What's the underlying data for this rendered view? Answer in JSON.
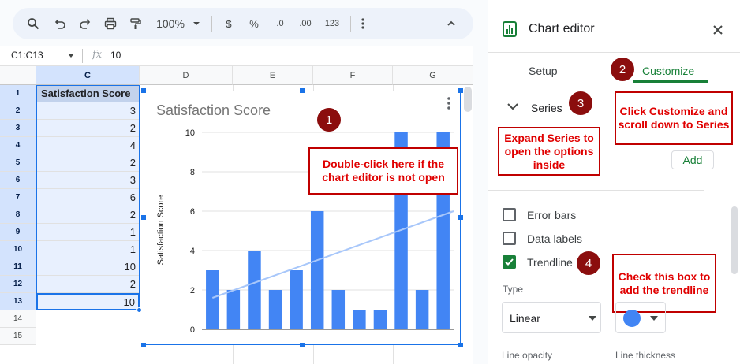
{
  "toolbar": {
    "zoom": "100%",
    "currency": "$",
    "percent": "%",
    "decrease_decimal": ".0",
    "increase_decimal": ".00",
    "format_number": "123"
  },
  "formula_bar": {
    "name_box": "C1:C13",
    "fx": "fx",
    "value": "10"
  },
  "grid": {
    "columns": [
      "C",
      "D",
      "E",
      "F",
      "G"
    ],
    "rows": [
      "1",
      "2",
      "3",
      "4",
      "5",
      "6",
      "7",
      "8",
      "9",
      "10",
      "11",
      "12",
      "13",
      "14",
      "15"
    ],
    "header_cell": "Satisfaction Score",
    "values": [
      "3",
      "2",
      "4",
      "2",
      "3",
      "6",
      "2",
      "1",
      "1",
      "10",
      "2",
      "10"
    ]
  },
  "chart_data": {
    "type": "bar",
    "title": "Satisfaction Score",
    "ylabel": "Satisfaction Score",
    "values": [
      3,
      2,
      4,
      2,
      3,
      6,
      2,
      1,
      1,
      10,
      2,
      10
    ],
    "ylim": [
      0,
      10
    ],
    "yticks": [
      "0",
      "2",
      "4",
      "6",
      "8",
      "10"
    ],
    "trendline": {
      "type": "linear",
      "start": 1.6,
      "end": 6.0
    },
    "color": "#4285f4",
    "trend_color": "#a8c7fa"
  },
  "callouts": {
    "c1": "Double-click here if the chart editor is not open",
    "c2": "Click Customize and scroll down to Series",
    "c3": "Expand Series to open the options inside",
    "c4": "Check this box to add the trendline"
  },
  "badges": {
    "b1": "1",
    "b2": "2",
    "b3": "3",
    "b4": "4"
  },
  "editor": {
    "title": "Chart editor",
    "tab_setup": "Setup",
    "tab_customize": "Customize",
    "series_label": "Series",
    "add_button": "Add",
    "error_bars": "Error bars",
    "data_labels": "Data labels",
    "trendline": "Trendline",
    "type_label": "Type",
    "type_value": "Linear",
    "line_opacity": "Line opacity",
    "line_thickness": "Line thickness",
    "trend_swatch": "#4285f4"
  }
}
